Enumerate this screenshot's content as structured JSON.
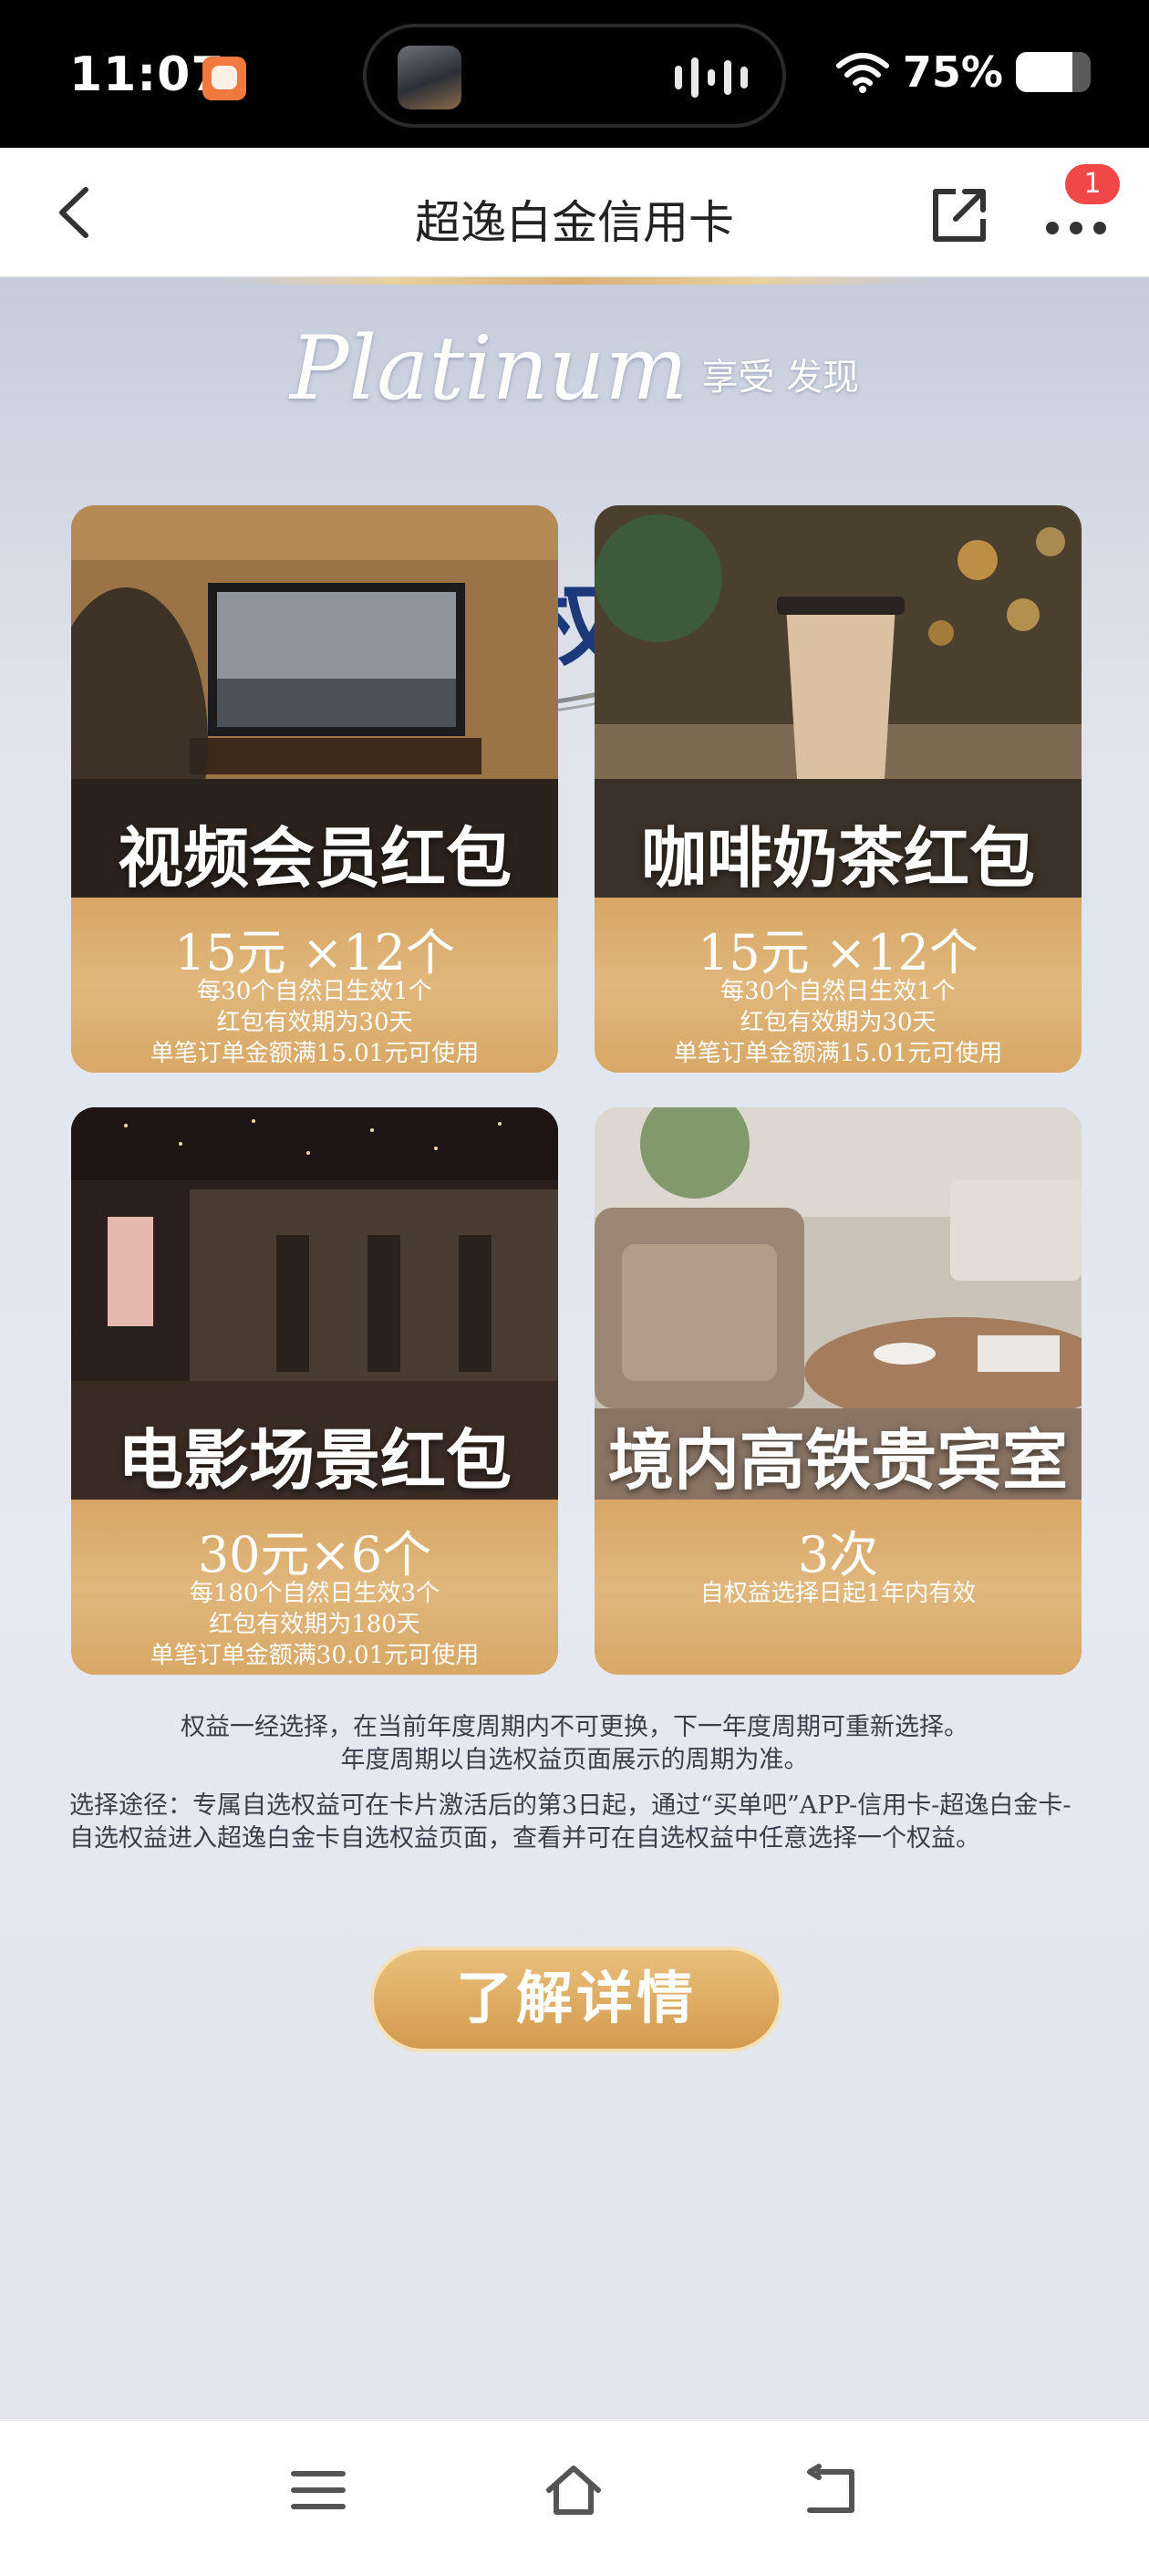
{
  "status_bar": {
    "time": "11:07",
    "battery_percent": "75%",
    "battery_level": 0.75,
    "icons": [
      "app-icon",
      "media-thumb-icon",
      "audio-wave-icon",
      "wifi-icon",
      "battery-icon"
    ]
  },
  "nav": {
    "title": "超逸白金信用卡",
    "badge_count": "1",
    "icons": [
      "back-icon",
      "share-icon",
      "more-icon"
    ]
  },
  "banner": {
    "brand_script": "Platinum",
    "brand_sub": "享受 发现",
    "headline": "专属自选权益多选一"
  },
  "cards": [
    {
      "title": "视频会员红包",
      "amount": "15元 ×12个",
      "desc": [
        "每30个自然日生效1个",
        "红包有效期为30天",
        "单笔订单金额满15.01元可使用"
      ]
    },
    {
      "title": "咖啡奶茶红包",
      "amount": "15元 ×12个",
      "desc": [
        "每30个自然日生效1个",
        "红包有效期为30天",
        "单笔订单金额满15.01元可使用"
      ]
    },
    {
      "title": "电影场景红包",
      "amount": "30元×6个",
      "desc": [
        "每180个自然日生效3个",
        "红包有效期为180天",
        "单笔订单金额满30.01元可使用"
      ]
    },
    {
      "title": "境内高铁贵宾室",
      "amount": "3次",
      "desc": [
        "自权益选择日起1年内有效"
      ]
    }
  ],
  "notes": {
    "line1": "权益一经选择，在当前年度周期内不可更换，下一年度周期可重新选择。",
    "line2": "年度周期以自选权益页面展示的周期为准。",
    "path": "选择途径：专属自选权益可在卡片激活后的第3日起，通过“买单吧”APP-信用卡-超逸白金卡-自选权益进入超逸白金卡自选权益页面，查看并可在自选权益中任意选择一个权益。"
  },
  "cta_label": "了解详情",
  "system_nav": [
    "menu-icon",
    "home-icon",
    "back-icon"
  ],
  "colors": {
    "headline": "#1c3a7a",
    "gold": "#d9a965",
    "badge": "#f04848"
  }
}
